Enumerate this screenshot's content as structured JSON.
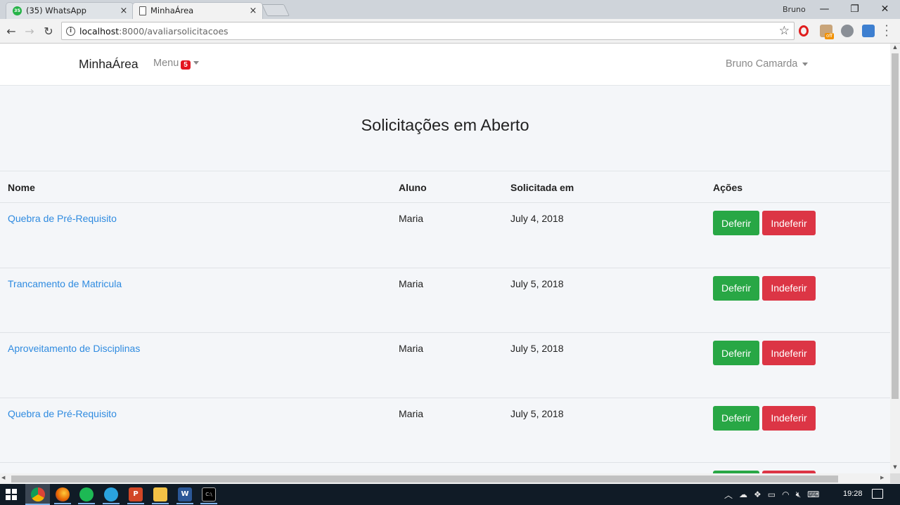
{
  "browser": {
    "tabs": [
      {
        "title": "(35) WhatsApp",
        "badge": "35",
        "active": false
      },
      {
        "title": "MinhaÁrea",
        "active": true
      }
    ],
    "profile_name": "Bruno",
    "url_host": "localhost",
    "url_path": ":8000/avaliarsolicitacoes",
    "extension_badge": "off",
    "close_glyph": "×",
    "window_controls": {
      "minimize": "—",
      "maximize": "❐",
      "close": "✕"
    }
  },
  "navbar": {
    "brand": "MinhaÁrea",
    "menu_label": "Menu",
    "menu_badge": "5",
    "user_name": "Bruno Camarda"
  },
  "page": {
    "title": "Solicitações em Aberto"
  },
  "table": {
    "headers": [
      "Nome",
      "Aluno",
      "Solicitada em",
      "Ações"
    ],
    "rows": [
      {
        "nome": "Quebra de Pré-Requisito",
        "aluno": "Maria",
        "data": "July 4, 2018",
        "deferir": "Deferir",
        "indeferir": "Indeferir"
      },
      {
        "nome": "Trancamento de Matricula",
        "aluno": "Maria",
        "data": "July 5, 2018",
        "deferir": "Deferir",
        "indeferir": "Indeferir"
      },
      {
        "nome": "Aproveitamento de Disciplinas",
        "aluno": "Maria",
        "data": "July 5, 2018",
        "deferir": "Deferir",
        "indeferir": "Indeferir"
      },
      {
        "nome": "Quebra de Pré-Requisito",
        "aluno": "Maria",
        "data": "July 5, 2018",
        "deferir": "Deferir",
        "indeferir": "Indeferir"
      }
    ]
  },
  "colors": {
    "link": "#2f8be0",
    "success": "#28a745",
    "danger": "#dc3545",
    "badge": "#e3141f"
  },
  "taskbar": {
    "apps": [
      "chrome-icon",
      "firefox-icon",
      "spotify-icon",
      "telegram-icon",
      "powerpoint-icon",
      "file-explorer-icon",
      "word-icon",
      "cmd-icon"
    ],
    "ppt_label": "P",
    "word_label": "W",
    "cmd_label": "C:\\",
    "clock": "19:28"
  }
}
